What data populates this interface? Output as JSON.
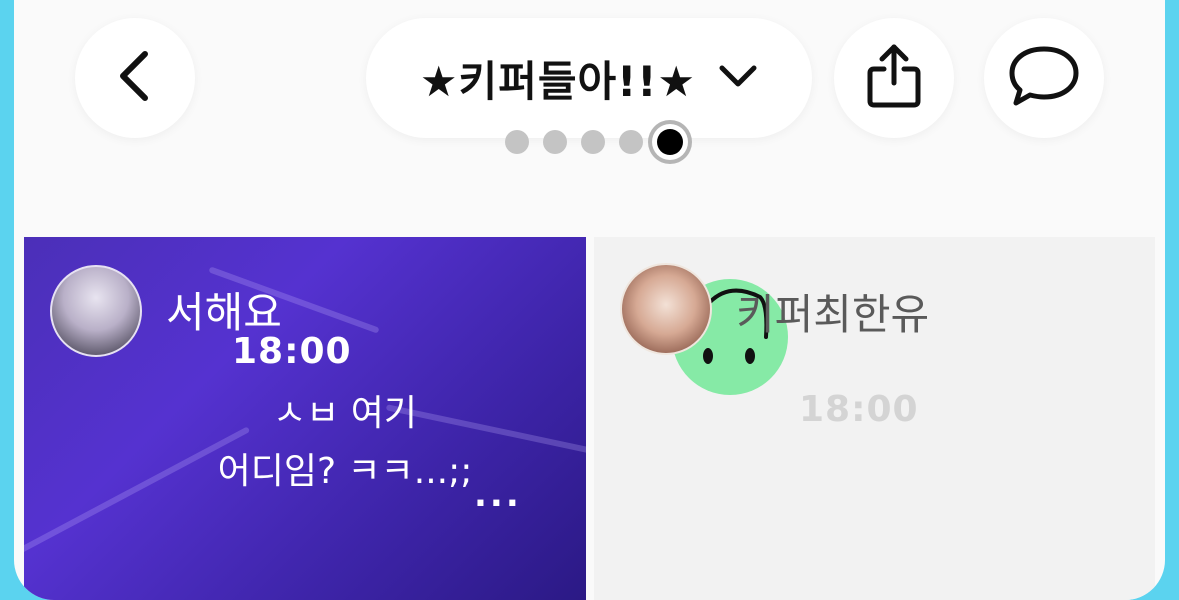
{
  "header": {
    "title": "★키퍼들아!!★",
    "back_icon": "chevron-left-icon",
    "dropdown_icon": "chevron-down-icon",
    "share_icon": "share-icon",
    "chat_icon": "speech-bubble-icon"
  },
  "pager": {
    "total": 5,
    "active": 5
  },
  "cards": [
    {
      "name": "서해요",
      "time": "18:00",
      "message_line1": "ㅅㅂ 여기",
      "message_line2": "어디임? ㅋㅋ...;;",
      "typing": "...",
      "background": "#4b2fb8"
    },
    {
      "name": "키퍼최한유",
      "time": "18:00",
      "smiley_color": "#86eaa6"
    }
  ],
  "colors": {
    "frame": "#5bd3ef",
    "screen": "#fafafa",
    "pager_inactive": "#c4c4c4",
    "pager_active": "#000000"
  }
}
